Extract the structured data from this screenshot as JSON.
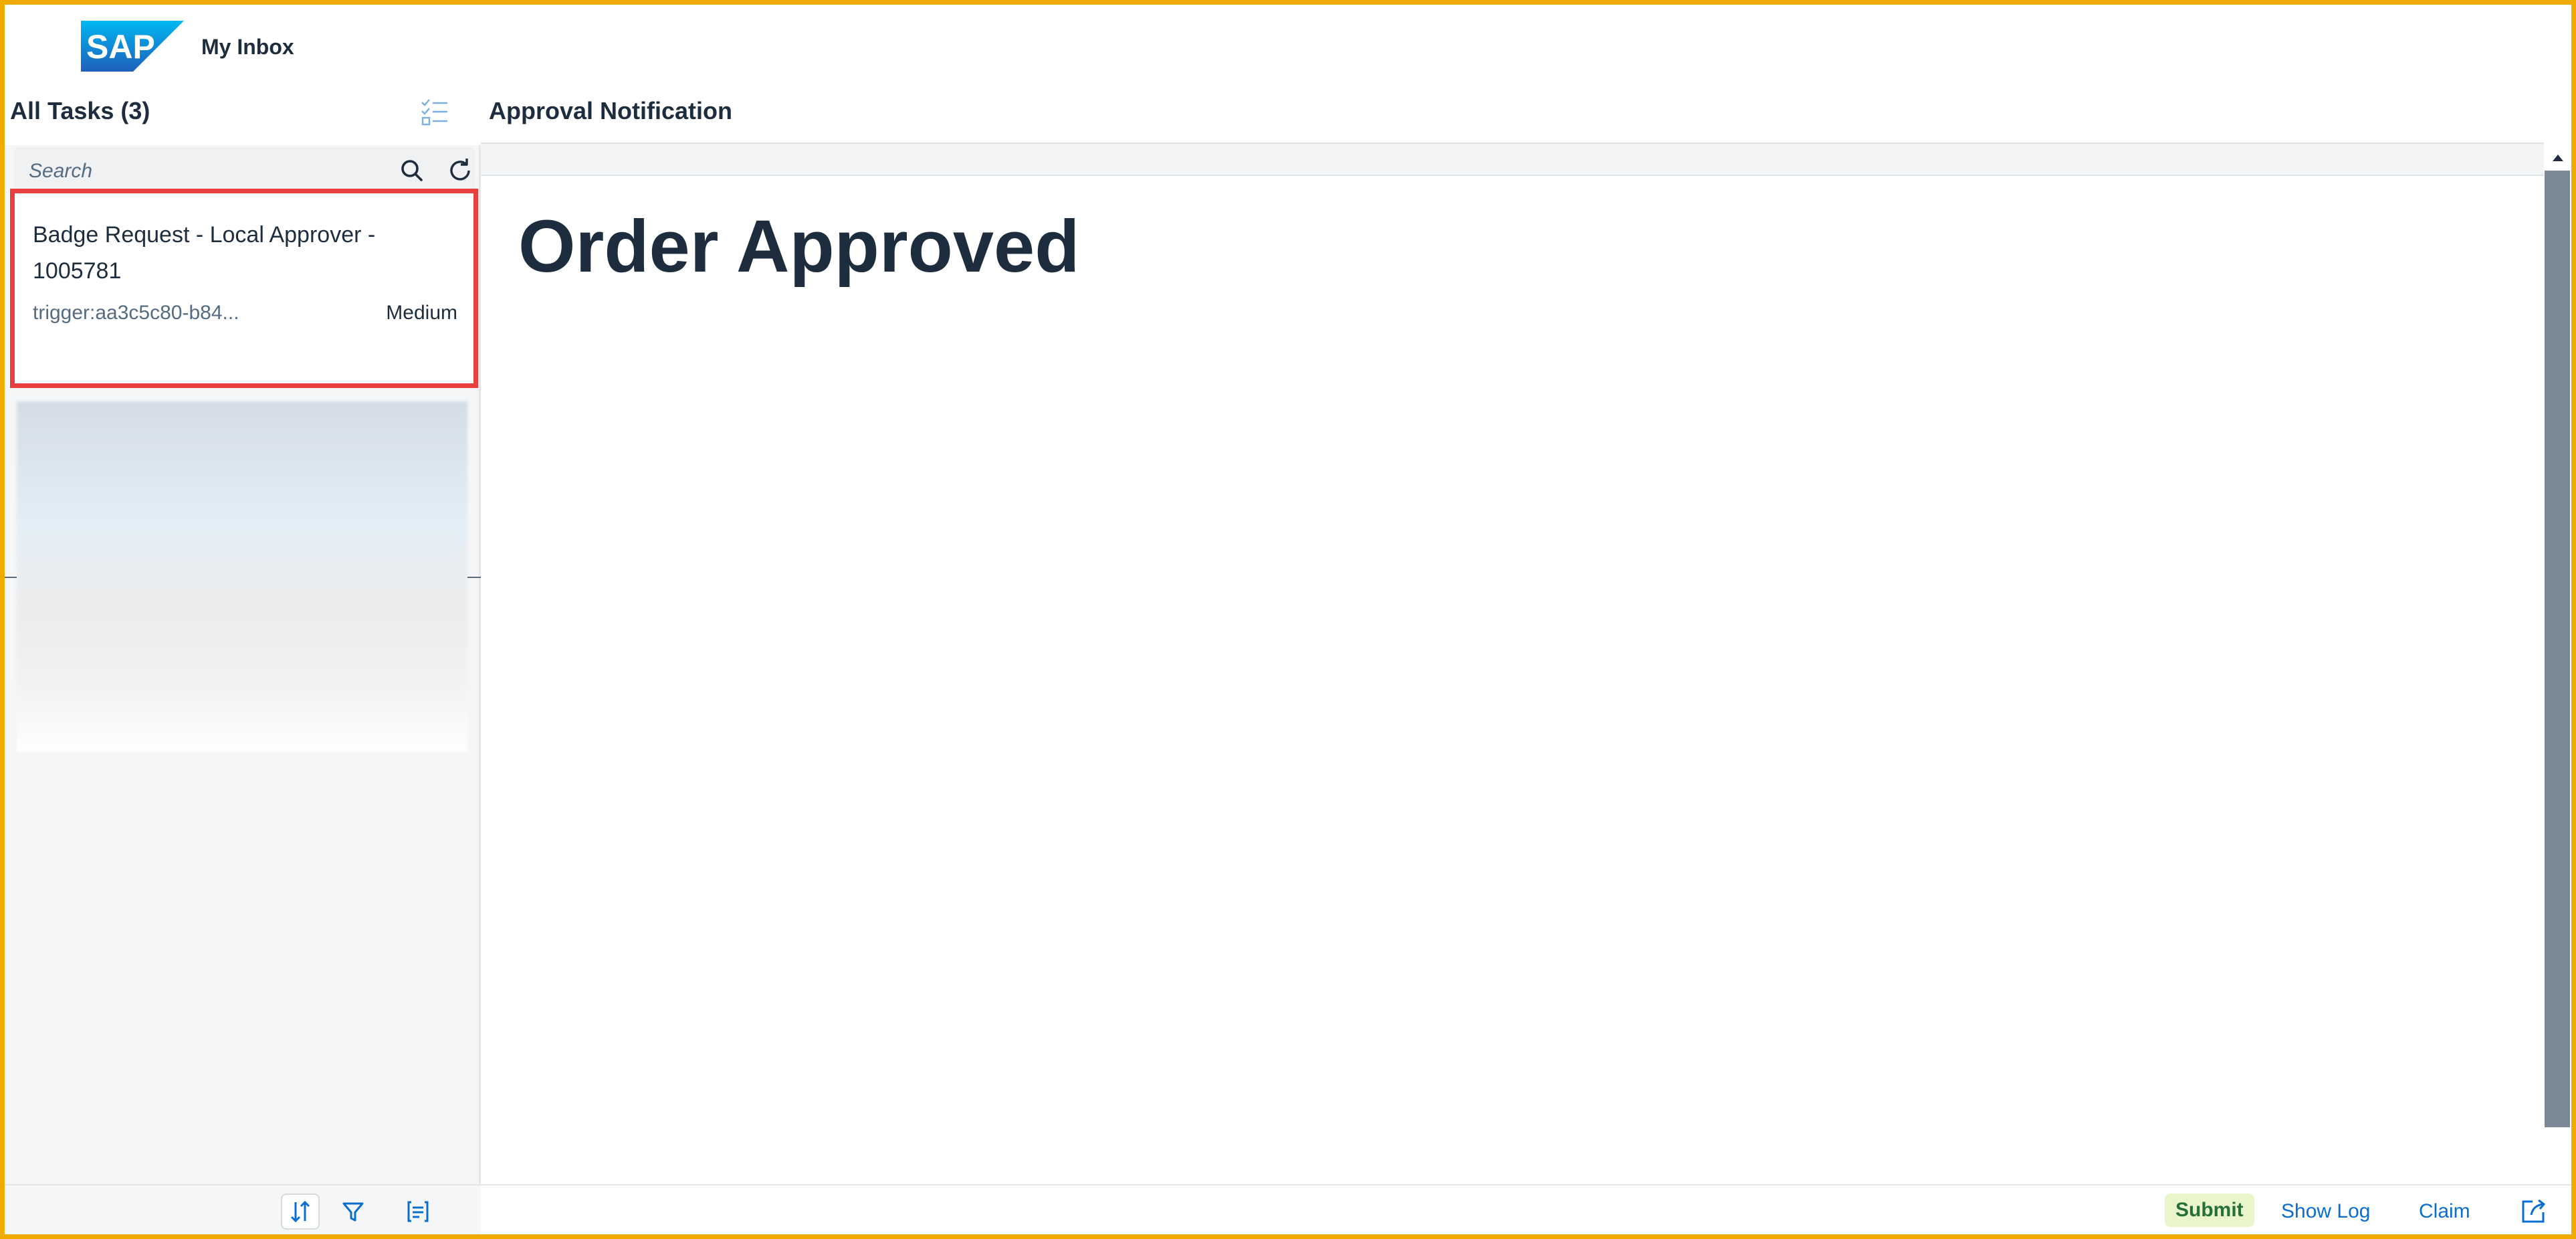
{
  "shell": {
    "logo_text": "SAP",
    "app_title": "My Inbox"
  },
  "master": {
    "title": "All Tasks (3)",
    "search": {
      "placeholder": "Search"
    },
    "tasks": [
      {
        "title": "Badge Request - Local Approver - 1005781",
        "subtitle": "trigger:aa3c5c80-b84...",
        "priority": "Medium"
      }
    ]
  },
  "detail": {
    "title": "Approval Notification",
    "heading": "Order Approved",
    "footer": {
      "submit_label": "Submit",
      "show_log_label": "Show Log",
      "claim_label": "Claim"
    }
  },
  "icons": {
    "multiselect": "multi-select-icon",
    "search": "search-icon",
    "refresh": "refresh-icon",
    "sort": "sort-icon",
    "filter": "filter-icon",
    "group": "group-icon",
    "open": "open-in-new-icon"
  },
  "colors": {
    "brand": "#0a6ed1",
    "frame": "#f0ab00",
    "highlight": "#e8403f",
    "submit_bg": "#ebf5cb"
  }
}
